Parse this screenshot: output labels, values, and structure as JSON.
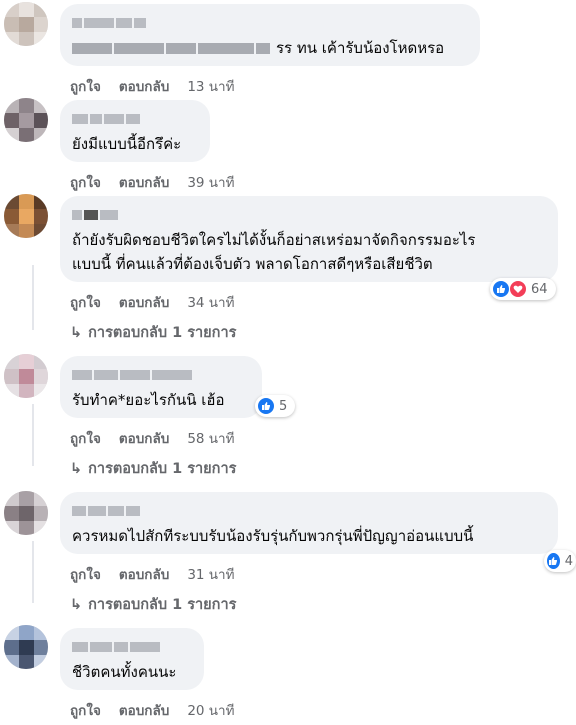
{
  "actions": {
    "like": "ถูกใจ",
    "reply": "ตอบกลับ"
  },
  "comments": [
    {
      "text": "รร ทน เค้ารับน้องโหดหรอ",
      "time": "13 นาที"
    },
    {
      "text": "ยังมีแบบนี้อีกรึค่ะ",
      "time": "39 นาที"
    },
    {
      "text_line1": "ถ้ายังรับผิดชอบชีวิตใครไม่ได้งั้นก็อย่าสเหร่อมาจัดกิจกรรมอะไร",
      "text_line2": "แบบนี้ ที่คนแล้วที่ต้องเจ็บตัว พลาดโอกาสดีๆหรือเสียชีวิต",
      "time": "34 นาที",
      "reaction_count": "64",
      "replies": "การตอบกลับ 1 รายการ"
    },
    {
      "text": "รับทำค*ยอะไรกันนิ เฮ้อ",
      "time": "58 นาที",
      "reaction_count": "5",
      "replies": "การตอบกลับ 1 รายการ"
    },
    {
      "text": "ควรหมดไปสักทีระบบรับน้องรับรุ่นกับพวกรุ่นพี่ปัญญาอ่อนแบบนี้",
      "time": "31 นาที",
      "reaction_count": "4",
      "replies": "การตอบกลับ 1 รายการ"
    },
    {
      "text": "ชีวิตคนทั้งคนนะ",
      "time": "20 นาที"
    }
  ],
  "colors": {
    "bubble": "#f0f2f5",
    "meta": "#65676b",
    "like": "#1877f2",
    "love": "#f33e58"
  },
  "icons": [
    "like-icon",
    "love-icon",
    "reply-arrow-icon"
  ]
}
